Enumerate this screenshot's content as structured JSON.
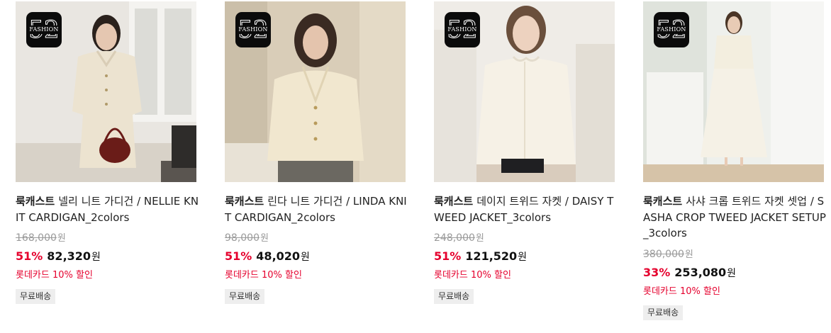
{
  "products": [
    {
      "brand": "룩캐스트",
      "name": "넬리 니트 가디건 / NELLIE KNIT CARDIGAN_2colors",
      "original_price": "168,000",
      "discount_rate": "51%",
      "sale_price": "82,320",
      "currency": "원",
      "promo": "롯데카드 10% 할인",
      "tag": "무료배송",
      "badge_number": "52",
      "badge_word": "FASHION"
    },
    {
      "brand": "룩캐스트",
      "name": "린다 니트 가디건 / LINDA KNIT CARDIGAN_2colors",
      "original_price": "98,000",
      "discount_rate": "51%",
      "sale_price": "48,020",
      "currency": "원",
      "promo": "롯데카드 10% 할인",
      "tag": "무료배송",
      "badge_number": "52",
      "badge_word": "FASHION"
    },
    {
      "brand": "룩캐스트",
      "name": "데이지 트위드 자켓 / DAISY TWEED JACKET_3colors",
      "original_price": "248,000",
      "discount_rate": "51%",
      "sale_price": "121,520",
      "currency": "원",
      "promo": "롯데카드 10% 할인",
      "tag": "무료배송",
      "badge_number": "52",
      "badge_word": "FASHION"
    },
    {
      "brand": "룩캐스트",
      "name": "사샤 크롭 트위드 자켓 셋업 / SASHA CROP TWEED JACKET SETUP_3colors",
      "original_price": "380,000",
      "discount_rate": "33%",
      "sale_price": "253,080",
      "currency": "원",
      "promo": "롯데카드 10% 할인",
      "tag": "무료배송",
      "badge_number": "52",
      "badge_word": "FASHION"
    }
  ],
  "colors": {
    "discount": "#e5002d",
    "promo": "#e5002d",
    "original_price": "#9a9a9a",
    "tag_bg": "#eeeeee"
  }
}
